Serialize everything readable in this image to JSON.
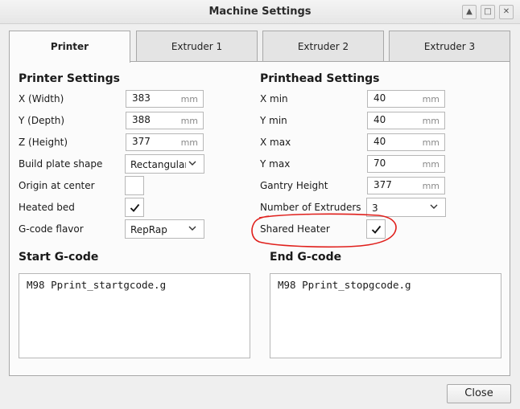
{
  "window": {
    "title": "Machine Settings",
    "buttons": [
      "restore",
      "maximize",
      "close"
    ]
  },
  "tabs": [
    {
      "label": "Printer",
      "active": true
    },
    {
      "label": "Extruder 1",
      "active": false
    },
    {
      "label": "Extruder 2",
      "active": false
    },
    {
      "label": "Extruder 3",
      "active": false
    }
  ],
  "printer_settings": {
    "heading": "Printer Settings",
    "x_width": {
      "label": "X (Width)",
      "value": "383",
      "unit": "mm"
    },
    "y_depth": {
      "label": "Y (Depth)",
      "value": "388",
      "unit": "mm"
    },
    "z_height": {
      "label": "Z (Height)",
      "value": "377",
      "unit": "mm"
    },
    "build_plate_shape": {
      "label": "Build plate shape",
      "value": "Rectangular"
    },
    "origin_at_center": {
      "label": "Origin at center",
      "checked": false
    },
    "heated_bed": {
      "label": "Heated bed",
      "checked": true
    },
    "gcode_flavor": {
      "label": "G-code flavor",
      "value": "RepRap"
    }
  },
  "printhead_settings": {
    "heading": "Printhead Settings",
    "x_min": {
      "label": "X min",
      "value": "40",
      "unit": "mm"
    },
    "y_min": {
      "label": "Y min",
      "value": "40",
      "unit": "mm"
    },
    "x_max": {
      "label": "X max",
      "value": "40",
      "unit": "mm"
    },
    "y_max": {
      "label": "Y max",
      "value": "70",
      "unit": "mm"
    },
    "gantry_height": {
      "label": "Gantry Height",
      "value": "377",
      "unit": "mm"
    },
    "number_of_extruders": {
      "label": "Number of Extruders",
      "value": "3"
    },
    "shared_heater": {
      "label": "Shared Heater",
      "checked": true
    }
  },
  "start_gcode": {
    "heading": "Start G-code",
    "text": "M98 Pprint_startgcode.g"
  },
  "end_gcode": {
    "heading": "End G-code",
    "text": "M98 Pprint_stopgcode.g"
  },
  "footer": {
    "close_label": "Close"
  },
  "colors": {
    "annotation": "#e0201c",
    "accent": "#222222"
  }
}
